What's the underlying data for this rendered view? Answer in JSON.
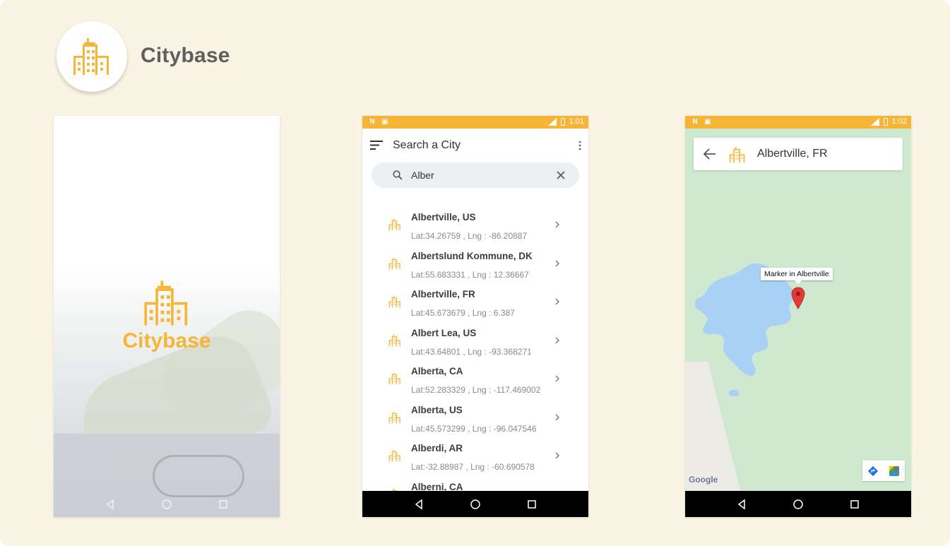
{
  "app": {
    "name": "Citybase",
    "accent_color": "#f6b536",
    "logo_icon": "city-building-icon"
  },
  "splash": {
    "title": "Citybase"
  },
  "search_screen": {
    "status_time": "1:01",
    "title": "Search a City",
    "search_value": "Alber",
    "results": [
      {
        "name": "Albertville, US",
        "coords": "Lat:34.26759 , Lng : -86.20887"
      },
      {
        "name": "Albertslund Kommune, DK",
        "coords": "Lat:55.683331 , Lng : 12.36667"
      },
      {
        "name": "Albertville, FR",
        "coords": "Lat:45.673679 , Lng : 6.387"
      },
      {
        "name": "Albert Lea, US",
        "coords": "Lat:43.64801 , Lng : -93.368271"
      },
      {
        "name": "Alberta, CA",
        "coords": "Lat:52.283329 , Lng : -117.469002"
      },
      {
        "name": "Alberta, US",
        "coords": "Lat:45.573299 , Lng : -96.047546"
      },
      {
        "name": "Alberdi, AR",
        "coords": "Lat:-32.88987 , Lng : -60.690578"
      },
      {
        "name": "Alberni, CA",
        "coords": ""
      }
    ]
  },
  "map_screen": {
    "status_time": "1:02",
    "title": "Albertville, FR",
    "marker_label": "Marker in Albertville",
    "attribution": "Google"
  }
}
